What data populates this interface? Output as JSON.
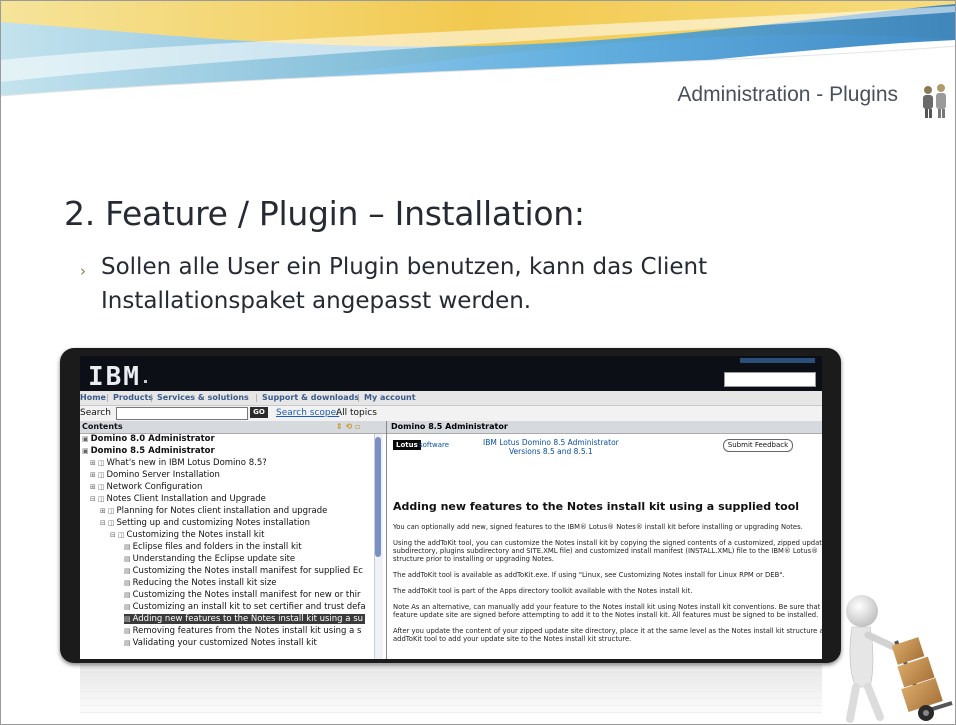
{
  "slide": {
    "header_title": "Administration - Plugins",
    "title": "2. Feature / Plugin – Installation:",
    "bullet_symbol": "›",
    "bullet_text": "Sollen alle User ein Plugin benutzen, kann das Client Installationspaket angepasst werden."
  },
  "screenshot": {
    "logo": "IBM",
    "nav": [
      "Home",
      "Products",
      "Services & solutions",
      "Support & downloads",
      "My account"
    ],
    "search": {
      "label": "Search",
      "go": "GO",
      "scope_link": "Search scope:",
      "scope_value": "All topics"
    },
    "contents": {
      "header": "Contents",
      "items": [
        {
          "text": "Domino 8.0 Administrator",
          "bold": true
        },
        {
          "text": "Domino 8.5 Administrator",
          "bold": true
        },
        {
          "text": "What's new in IBM Lotus Domino 8.5?"
        },
        {
          "text": "Domino Server Installation"
        },
        {
          "text": "Network Configuration"
        },
        {
          "text": "Notes Client Installation and Upgrade"
        },
        {
          "text": "Planning for Notes client installation and upgrade"
        },
        {
          "text": "Setting up and customizing Notes installation"
        },
        {
          "text": "Customizing the Notes install kit"
        },
        {
          "text": "Eclipse files and folders in the install kit"
        },
        {
          "text": "Understanding the Eclipse update site"
        },
        {
          "text": "Customizing the Notes install manifest for supplied Ec"
        },
        {
          "text": "Reducing the Notes install kit size"
        },
        {
          "text": "Customizing the Notes install manifest for new or thir"
        },
        {
          "text": "Customizing an install kit to set certifier and trust defa"
        },
        {
          "text": "Adding new features to the Notes install kit using a su",
          "selected": true
        },
        {
          "text": "Removing features from the Notes install kit using a s"
        },
        {
          "text": "Validating your customized Notes install kit"
        }
      ]
    },
    "document": {
      "header": "Domino 8.5 Administrator",
      "lotus_logo": "Lotus",
      "lotus_software": "software",
      "product_title_line1": "IBM Lotus Domino 8.5 Administrator",
      "product_title_line2": "Versions 8.5 and 8.5.1",
      "submit_feedback": "Submit Feedback",
      "title": "Adding new features to the Notes install kit using a supplied tool",
      "paragraphs": [
        "You can optionally add new, signed features to the IBM® Lotus® Notes® install kit before installing or upgrading Notes.",
        "Using the addToKit tool, you can customize the Notes install kit by copying the signed contents of a customized, zipped updat",
        "subdirectory, plugins subdirectory and SITE.XML file) and customized install manifest (INSTALL.XML) file to the IBM® Lotus®",
        "structure prior to installing or upgrading Notes.",
        "The addToKit tool is available as addToKit.exe. If using \"Linux, see Customizing Notes install for Linux RPM or DEB\".",
        "The addToKit tool is part of the Apps directory toolkit available with the Notes install kit.",
        "Note As an alternative, can manually add your feature to the Notes install kit using Notes install kit conventions. Be sure that t",
        "feature update site are signed before attempting to add it to the Notes install kit. All features must be signed to be installed.",
        "After you update the content of your zipped update site directory, place it at the same level as the Notes install kit structure an",
        "addToKit tool to add your update site to the Notes install kit structure."
      ]
    }
  },
  "colors": {
    "title_text": "#262a33",
    "header_text": "#4a4f5c",
    "banner_yellow": "#f2cf63",
    "banner_blue": "#4fa6dc",
    "selected_row": "#3b3b3b"
  }
}
